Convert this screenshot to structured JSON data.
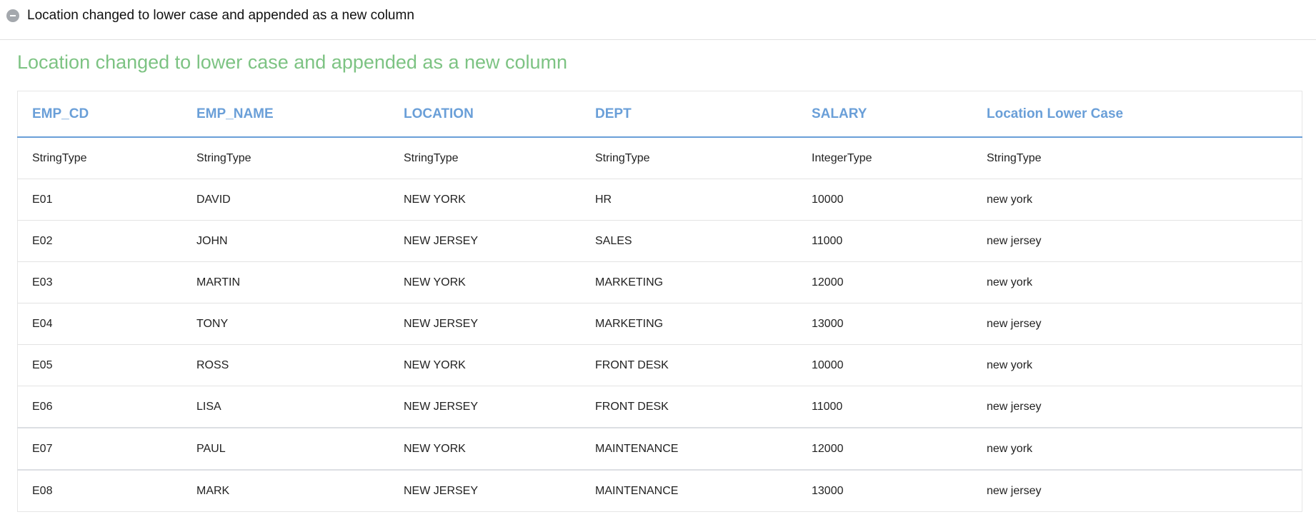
{
  "section": {
    "title": "Location changed to lower case and appended as a new column",
    "toggle_icon": "collapse-minus-icon"
  },
  "heading": "Location changed to lower case and appended as a new column",
  "colors": {
    "accent_green": "#7dc383",
    "header_blue": "#6a9fd8"
  },
  "table": {
    "headers": [
      "EMP_CD",
      "EMP_NAME",
      "LOCATION",
      "DEPT",
      "SALARY",
      "Location Lower Case"
    ],
    "types": [
      "StringType",
      "StringType",
      "StringType",
      "StringType",
      "IntegerType",
      "StringType"
    ],
    "rows": [
      [
        "E01",
        "DAVID",
        "NEW YORK",
        "HR",
        "10000",
        "new york"
      ],
      [
        "E02",
        "JOHN",
        "NEW JERSEY",
        "SALES",
        "11000",
        "new jersey"
      ],
      [
        "E03",
        "MARTIN",
        "NEW YORK",
        "MARKETING",
        "12000",
        "new york"
      ],
      [
        "E04",
        "TONY",
        "NEW JERSEY",
        "MARKETING",
        "13000",
        "new jersey"
      ],
      [
        "E05",
        "ROSS",
        "NEW YORK",
        "FRONT DESK",
        "10000",
        "new york"
      ],
      [
        "E06",
        "LISA",
        "NEW JERSEY",
        "FRONT DESK",
        "11000",
        "new jersey"
      ],
      [
        "E07",
        "PAUL",
        "NEW YORK",
        "MAINTENANCE",
        "12000",
        "new york"
      ],
      [
        "E08",
        "MARK",
        "NEW JERSEY",
        "MAINTENANCE",
        "13000",
        "new jersey"
      ]
    ]
  }
}
